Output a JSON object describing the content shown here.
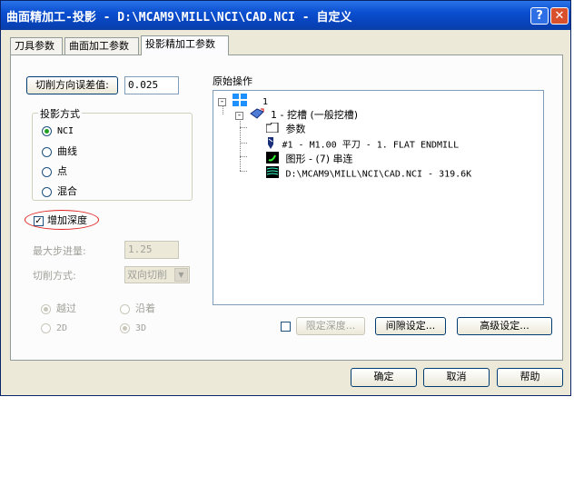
{
  "window": {
    "title": "曲面精加工-投影 - D:\\MCAM9\\MILL\\NCI\\CAD.NCI - 自定义",
    "help_label": "?",
    "close_label": "✕"
  },
  "tabs": [
    {
      "label": "刀具参数"
    },
    {
      "label": "曲面加工参数"
    },
    {
      "label": "投影精加工参数"
    }
  ],
  "left": {
    "tolerance_button": "切削方向误差值:",
    "tolerance_value": "0.025",
    "projection_group_title": "投影方式",
    "projection_options": [
      {
        "label": "NCI",
        "selected": true
      },
      {
        "label": "曲线",
        "selected": false
      },
      {
        "label": "点",
        "selected": false
      },
      {
        "label": "混合",
        "selected": false
      }
    ],
    "add_depth_label": "增加深度",
    "add_depth_checked": true,
    "max_step_label": "最大步进量:",
    "max_step_value": "1.25",
    "cut_method_label": "切削方式:",
    "cut_method_value": "双向切削",
    "radio_pairs": [
      {
        "label": "越过",
        "selected": true
      },
      {
        "label": "沿着",
        "selected": false
      },
      {
        "label": "2D",
        "selected": false
      },
      {
        "label": "3D",
        "selected": true
      }
    ]
  },
  "tree": {
    "title": "原始操作",
    "root_label": "1",
    "operation_label": "1 - 挖槽 (一般挖槽)",
    "children": [
      {
        "label": "参数",
        "icon": "folder-icon"
      },
      {
        "label": "#1 - M1.00 平刀 -  1. FLAT ENDMILL",
        "icon": "tool-icon"
      },
      {
        "label": "图形 - (7)  串连",
        "icon": "geometry-icon"
      },
      {
        "label": "D:\\MCAM9\\MILL\\NCI\\CAD.NCI - 319.6K",
        "icon": "nci-file-icon"
      }
    ]
  },
  "bottom": {
    "limit_depth_label": "限定深度...",
    "gap_settings_label": "间隙设定...",
    "advanced_settings_label": "高级设定...",
    "ok_label": "确定",
    "cancel_label": "取消",
    "help_button_label": "帮助"
  },
  "colors": {
    "titlebar": "#0a4fd0",
    "dialog_bg": "#ece9d8",
    "annotation_red": "#e02020"
  }
}
